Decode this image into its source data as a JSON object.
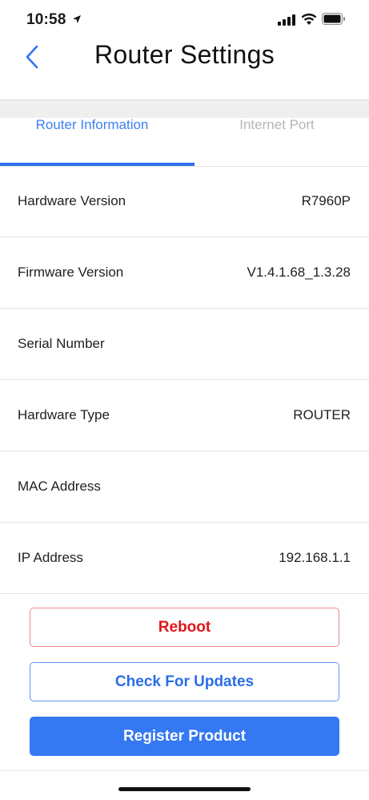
{
  "status_bar": {
    "time": "10:58"
  },
  "header": {
    "title": "Router Settings"
  },
  "tabs": [
    {
      "label": "Router Information",
      "active": true
    },
    {
      "label": "Internet Port",
      "active": false
    }
  ],
  "info_rows": [
    {
      "label": "Hardware Version",
      "value": "R7960P"
    },
    {
      "label": "Firmware Version",
      "value": "V1.4.1.68_1.3.28"
    },
    {
      "label": "Serial Number",
      "value": ""
    },
    {
      "label": "Hardware Type",
      "value": "ROUTER"
    },
    {
      "label": "MAC Address",
      "value": ""
    },
    {
      "label": "IP Address",
      "value": "192.168.1.1"
    }
  ],
  "buttons": {
    "reboot": "Reboot",
    "check_updates": "Check For Updates",
    "register": "Register Product"
  },
  "colors": {
    "accent": "#3478f2",
    "danger": "#e0161a",
    "tab_inactive": "#b6b6b6"
  }
}
